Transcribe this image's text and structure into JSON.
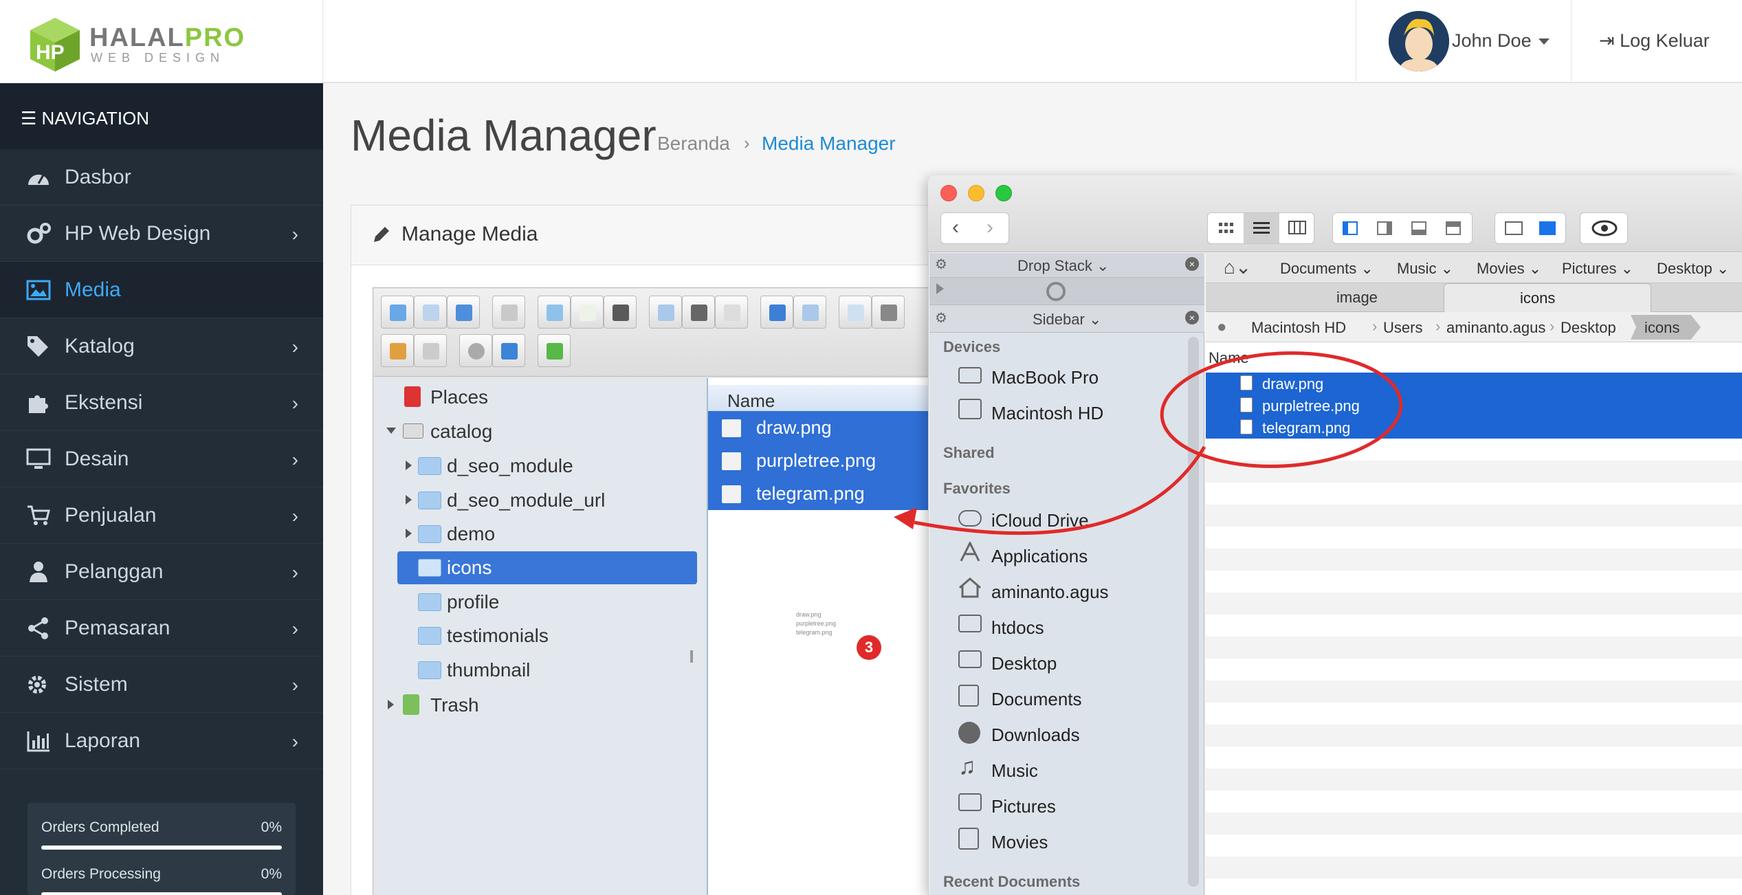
{
  "brand": {
    "name_part1": "HALAL",
    "name_part2": "PRO",
    "tagline": "WEB DESIGN"
  },
  "header": {
    "user_name": "John Doe",
    "logout_label": "Log Keluar"
  },
  "sidebar": {
    "nav_title": "NAVIGATION",
    "items": [
      {
        "label": "Dasbor",
        "icon": "dashboard-icon",
        "has_children": false
      },
      {
        "label": "HP Web Design",
        "icon": "gears-icon",
        "has_children": true
      },
      {
        "label": "Media",
        "icon": "image-icon",
        "has_children": false,
        "active": true
      },
      {
        "label": "Katalog",
        "icon": "tags-icon",
        "has_children": true
      },
      {
        "label": "Ekstensi",
        "icon": "puzzle-icon",
        "has_children": true
      },
      {
        "label": "Desain",
        "icon": "desktop-icon",
        "has_children": true
      },
      {
        "label": "Penjualan",
        "icon": "cart-icon",
        "has_children": true
      },
      {
        "label": "Pelanggan",
        "icon": "user-icon",
        "has_children": true
      },
      {
        "label": "Pemasaran",
        "icon": "share-icon",
        "has_children": true
      },
      {
        "label": "Sistem",
        "icon": "cog-icon",
        "has_children": true
      },
      {
        "label": "Laporan",
        "icon": "bar-chart-icon",
        "has_children": true
      }
    ],
    "stats": [
      {
        "label": "Orders Completed",
        "value": "0%"
      },
      {
        "label": "Orders Processing",
        "value": "0%"
      }
    ]
  },
  "page": {
    "title": "Media Manager",
    "breadcrumb": [
      "Beranda",
      "Media Manager"
    ],
    "panel_title": "Manage Media"
  },
  "file_manager": {
    "tree": {
      "places": "Places",
      "root": "catalog",
      "folders": [
        "d_seo_module",
        "d_seo_module_url",
        "demo",
        "icons",
        "profile",
        "testimonials",
        "thumbnail"
      ],
      "selected": "icons",
      "trash": "Trash"
    },
    "column_name": "Name",
    "files": [
      "draw.png",
      "purpletree.png",
      "telegram.png"
    ],
    "drag_badge": "3"
  },
  "finder": {
    "sidebar_bar1": "Drop Stack",
    "sidebar_bar3": "Sidebar",
    "sections": {
      "devices": "Devices",
      "shared": "Shared",
      "favorites": "Favorites",
      "recent": "Recent Documents"
    },
    "devices": [
      "MacBook Pro",
      "Macintosh HD"
    ],
    "favorites": [
      "iCloud Drive",
      "Applications",
      "aminanto.agus",
      "htdocs",
      "Desktop",
      "Documents",
      "Downloads",
      "Music",
      "Pictures",
      "Movies"
    ],
    "location_bar": [
      "Documents",
      "Music",
      "Movies",
      "Pictures",
      "Desktop"
    ],
    "tabs": [
      "image",
      "icons"
    ],
    "path": [
      "Macintosh HD",
      "Users",
      "aminanto.agus",
      "Desktop",
      "icons"
    ],
    "column_name": "Name",
    "files": [
      "draw.png",
      "purpletree.png",
      "telegram.png"
    ]
  },
  "colors": {
    "sidebar_bg": "#222d37",
    "accent_blue": "#1e8ad6",
    "selection_blue": "#1c65d2",
    "brand_green": "#8dc63f",
    "annotation_red": "#e02a2a"
  }
}
